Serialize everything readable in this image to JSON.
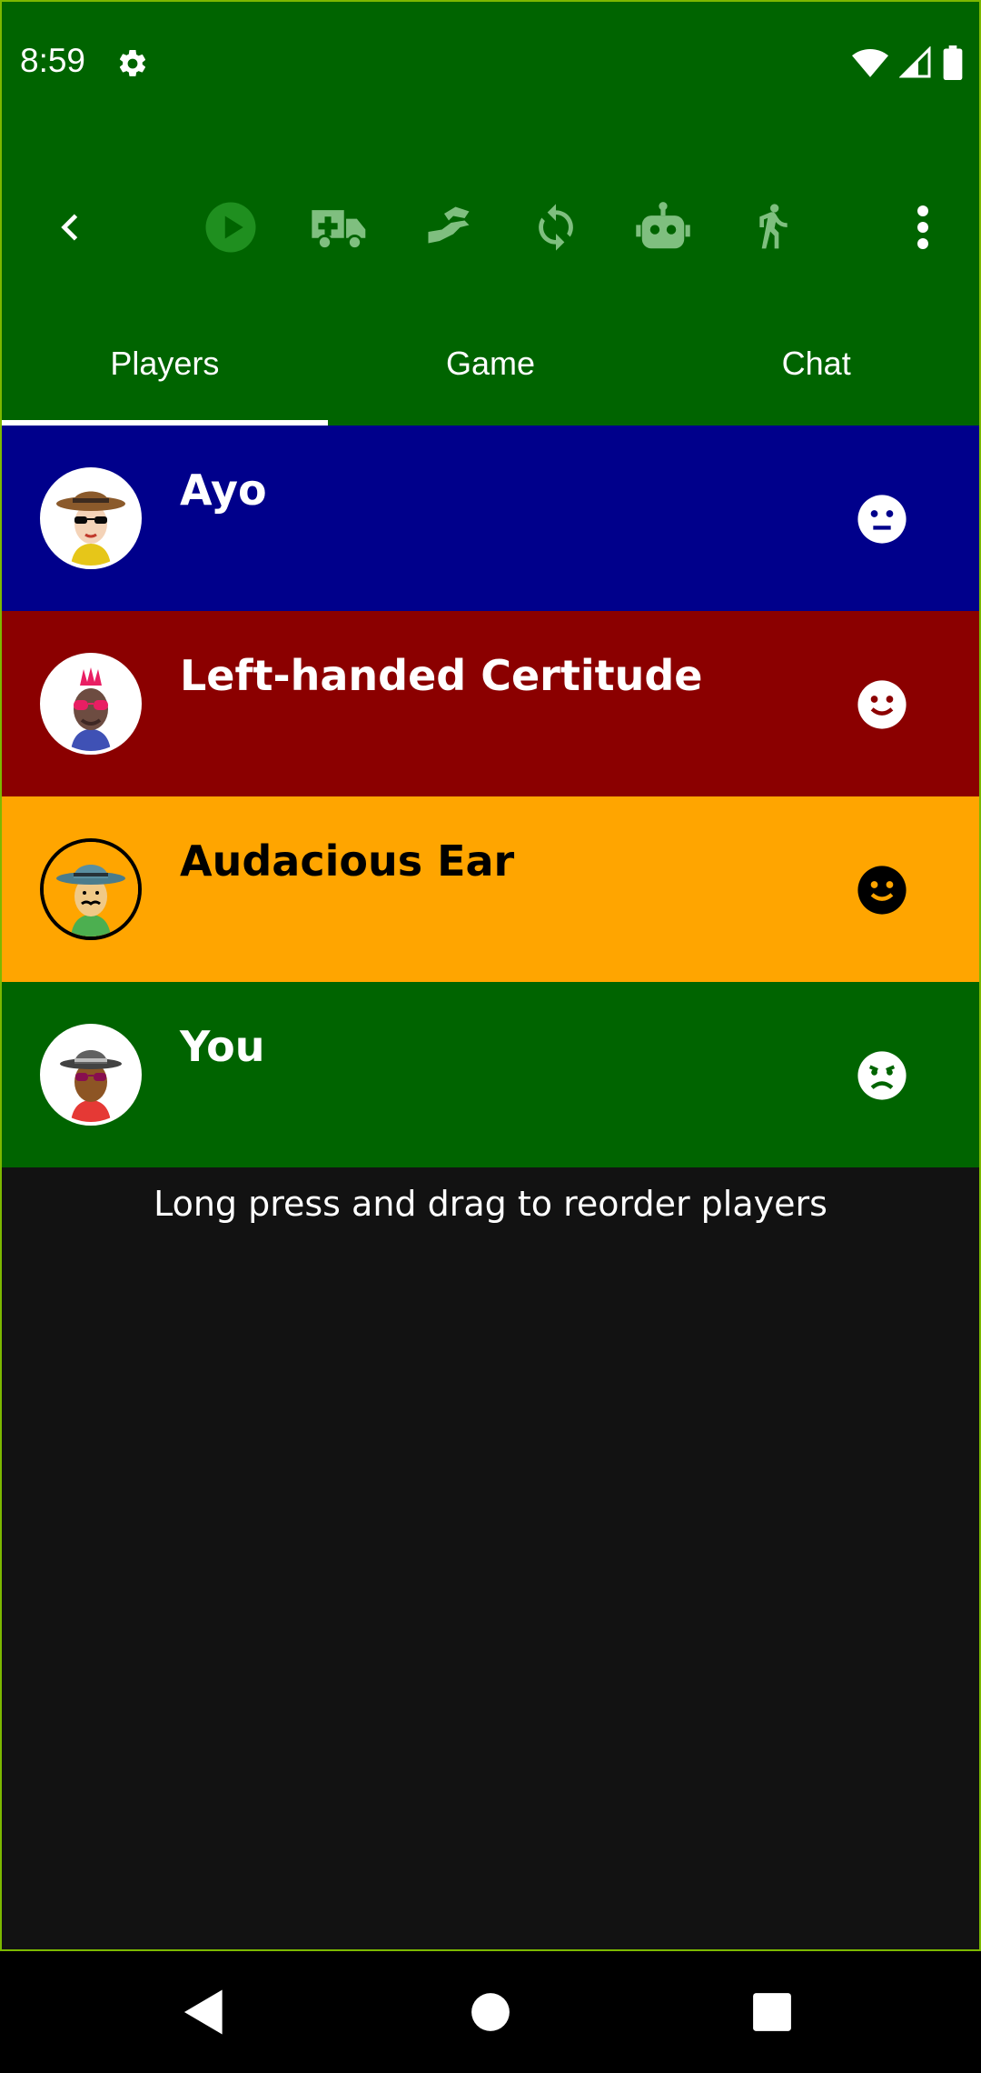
{
  "status_bar": {
    "time": "8:59",
    "icons": [
      "gear-icon",
      "wifi-icon",
      "signal-icon",
      "battery-icon"
    ]
  },
  "toolbar": {
    "icons": [
      "back-chevron-icon",
      "play-circle-icon",
      "ambulance-icon",
      "swap-hand-icon",
      "sync-icon",
      "robot-icon",
      "walking-icon",
      "more-vert-icon"
    ]
  },
  "tabs": [
    {
      "label": "Players",
      "active": true
    },
    {
      "label": "Game",
      "active": false
    },
    {
      "label": "Chat",
      "active": false
    }
  ],
  "players": [
    {
      "name": "Ayo",
      "bg": "#00008b",
      "fg": "#ffffff",
      "mood": "neutral-face-icon"
    },
    {
      "name": "Left-handed Certitude",
      "bg": "#8b0000",
      "fg": "#ffffff",
      "mood": "smile-face-icon"
    },
    {
      "name": "Audacious Ear",
      "bg": "#ffa500",
      "fg": "#000000",
      "mood": "smile-face-icon"
    },
    {
      "name": "You",
      "bg": "#006400",
      "fg": "#ffffff",
      "mood": "frown-face-icon"
    }
  ],
  "hint": "Long press and drag to reorder players",
  "colors": {
    "appbar": "#006400",
    "background": "#121212",
    "frame_border": "#7cb800"
  }
}
